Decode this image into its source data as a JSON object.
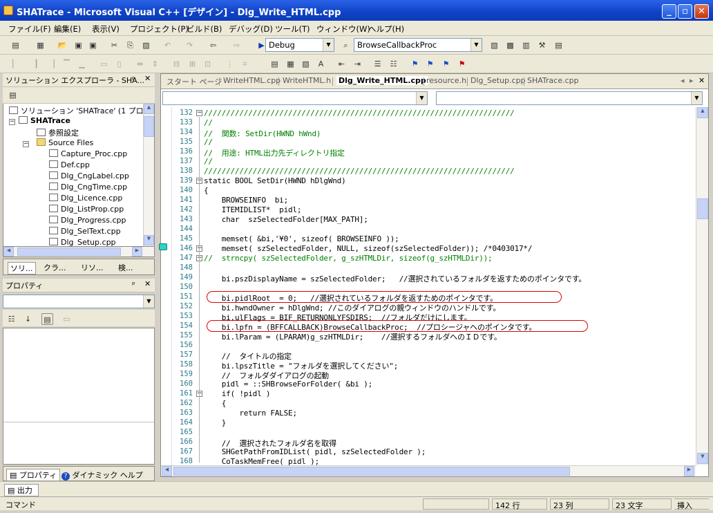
{
  "window": {
    "title": "SHATrace - Microsoft Visual C++ [デザイン] - Dlg_Write_HTML.cpp"
  },
  "menu": [
    "ファイル(F)",
    "編集(E)",
    "表示(V)",
    "プロジェクト(P)",
    "ビルド(B)",
    "デバッグ(D)",
    "ツール(T)",
    "ウィンドウ(W)",
    "ヘルプ(H)"
  ],
  "toolbar": {
    "config": "Debug",
    "function": "BrowseCallbackProc"
  },
  "solution_explorer": {
    "title": "ソリューション エクスプローラ - SHA...",
    "items": [
      {
        "label": "ソリューション 'SHATrace' (1 プロジェクト)",
        "bold": false
      },
      {
        "label": "SHATrace",
        "bold": true
      },
      {
        "label": "参照設定",
        "bold": false
      },
      {
        "label": "Source Files",
        "bold": false
      },
      {
        "label": "Capture_Proc.cpp",
        "bold": false
      },
      {
        "label": "Def.cpp",
        "bold": false
      },
      {
        "label": "Dlg_CngLabel.cpp",
        "bold": false
      },
      {
        "label": "Dlg_CngTime.cpp",
        "bold": false
      },
      {
        "label": "Dlg_Licence.cpp",
        "bold": false
      },
      {
        "label": "Dlg_ListProp.cpp",
        "bold": false
      },
      {
        "label": "Dlg_Progress.cpp",
        "bold": false
      },
      {
        "label": "Dlg_SelText.cpp",
        "bold": false
      },
      {
        "label": "Dlg_Setup.cpp",
        "bold": false
      }
    ],
    "tabs": [
      "ソリ...",
      "クラ...",
      "リソ...",
      "検..."
    ]
  },
  "properties": {
    "title": "プロパティ"
  },
  "bottom_tabs": [
    "プロパティ",
    "ダイナミック ヘルプ"
  ],
  "output_tab": "出力",
  "editor": {
    "tabs": [
      "スタート ページ",
      "WriteHTML.cpp",
      "WriteHTML.h",
      "Dlg_Write_HTML.cpp",
      "resource.h",
      "Dlg_Setup.cpp",
      "SHATrace.cpp"
    ],
    "active_tab": 3,
    "lines": [
      {
        "n": "132",
        "t": "//////////////////////////////////////////////////////////////////////",
        "c": "cm"
      },
      {
        "n": "133",
        "t": "//",
        "c": "cm"
      },
      {
        "n": "134",
        "t": "//  関数: SetDir(HWND hWnd)",
        "c": "cm"
      },
      {
        "n": "135",
        "t": "//",
        "c": "cm"
      },
      {
        "n": "136",
        "t": "//  用途: HTML出力先ディレクトリ指定",
        "c": "cm"
      },
      {
        "n": "137",
        "t": "//",
        "c": "cm"
      },
      {
        "n": "138",
        "t": "//////////////////////////////////////////////////////////////////////",
        "c": "cm"
      },
      {
        "n": "139",
        "t": "static BOOL SetDir(HWND hDlgWnd)",
        "c": ""
      },
      {
        "n": "140",
        "t": "{",
        "c": ""
      },
      {
        "n": "141",
        "t": "    BROWSEINFO  bi;",
        "c": ""
      },
      {
        "n": "142",
        "t": "    ITEMIDLIST*  pidl;",
        "c": ""
      },
      {
        "n": "143",
        "t": "    char  szSelectedFolder[MAX_PATH];",
        "c": ""
      },
      {
        "n": "144",
        "t": "",
        "c": ""
      },
      {
        "n": "145",
        "t": "    memset( &bi,'¥0', sizeof( BROWSEINFO ));",
        "c": ""
      },
      {
        "n": "146",
        "t": "    memset( szSelectedFolder, NULL, sizeof(szSelectedFolder)); /*0403017*/",
        "c": ""
      },
      {
        "n": "147",
        "t": "//  strncpy( szSelectedFolder, g_szHTMLDir, sizeof(g_szHTMLDir));",
        "c": "cm"
      },
      {
        "n": "148",
        "t": "",
        "c": ""
      },
      {
        "n": "149",
        "t": "    bi.pszDisplayName = szSelectedFolder;   //選択されているフォルダを返すためのポインタです。",
        "c": ""
      },
      {
        "n": "150",
        "t": "",
        "c": ""
      },
      {
        "n": "151",
        "t": "    bi.pidlRoot  = 0;   //選択されているフォルダを返すためのポインタです。",
        "c": ""
      },
      {
        "n": "152",
        "t": "    bi.hwndOwner = hDlgWnd; //このダイアログの親ウィンドウのハンドルです。",
        "c": ""
      },
      {
        "n": "153",
        "t": "    bi.ulFlags = BIF_RETURNONLYFSDIRS;  //フォルダだけにします。",
        "c": ""
      },
      {
        "n": "154",
        "t": "    bi.lpfn = (BFFCALLBACK)BrowseCallbackProc;  //プロシージャへのポインタです。",
        "c": ""
      },
      {
        "n": "155",
        "t": "    bi.lParam = (LPARAM)g_szHTMLDir;    //選択するフォルダへのＩＤです。",
        "c": ""
      },
      {
        "n": "156",
        "t": "",
        "c": ""
      },
      {
        "n": "157",
        "t": "    //  タイトルの指定",
        "c": ""
      },
      {
        "n": "158",
        "t": "    bi.lpszTitle = \"フォルダを選択してください\";",
        "c": ""
      },
      {
        "n": "159",
        "t": "    //  フォルダダイアログの起動",
        "c": ""
      },
      {
        "n": "160",
        "t": "    pidl = ::SHBrowseForFolder( &bi );",
        "c": ""
      },
      {
        "n": "161",
        "t": "    if( !pidl )",
        "c": ""
      },
      {
        "n": "162",
        "t": "    {",
        "c": ""
      },
      {
        "n": "163",
        "t": "        return FALSE;",
        "c": ""
      },
      {
        "n": "164",
        "t": "    }",
        "c": ""
      },
      {
        "n": "165",
        "t": "",
        "c": ""
      },
      {
        "n": "166",
        "t": "    //  選択されたフォルダ名を取得",
        "c": ""
      },
      {
        "n": "167",
        "t": "    SHGetPathFromIDList( pidl, szSelectedFolder );",
        "c": ""
      },
      {
        "n": "168",
        "t": "    CoTaskMemFree( pidl );",
        "c": ""
      }
    ]
  },
  "statusbar": {
    "left": "コマンド",
    "line": "142 行",
    "col": "23 列",
    "chars": "23 文字",
    "mode": "挿入"
  }
}
